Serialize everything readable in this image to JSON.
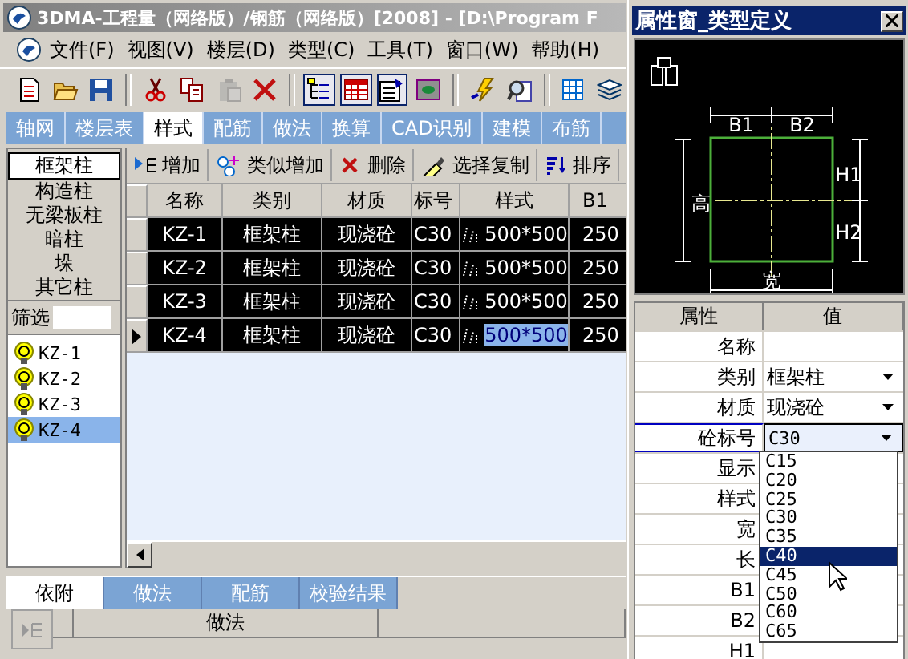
{
  "main_window": {
    "title": "3DMA-工程量（网络版）/钢筋（网络版）[2008] - [D:\\Program F",
    "menu": [
      "文件(F)",
      "视图(V)",
      "楼层(D)",
      "类型(C)",
      "工具(T)",
      "窗口(W)",
      "帮助(H)"
    ],
    "toolbar": [
      {
        "kind": "new"
      },
      {
        "kind": "open"
      },
      {
        "kind": "save"
      },
      {
        "kind": "sep"
      },
      {
        "kind": "cut"
      },
      {
        "kind": "copy"
      },
      {
        "kind": "paste",
        "disabled": true
      },
      {
        "kind": "delete"
      },
      {
        "kind": "sep"
      },
      {
        "kind": "tree",
        "on": true
      },
      {
        "kind": "table",
        "on": true
      },
      {
        "kind": "props",
        "on": true
      },
      {
        "kind": "display"
      },
      {
        "kind": "sep"
      },
      {
        "kind": "bolt"
      },
      {
        "kind": "find"
      },
      {
        "kind": "sep"
      },
      {
        "kind": "grid"
      },
      {
        "kind": "layers"
      }
    ],
    "tabs": [
      {
        "label": "轴网",
        "selected": false
      },
      {
        "label": "楼层表",
        "selected": false
      },
      {
        "label": "样式",
        "selected": true
      },
      {
        "label": "配筋",
        "selected": false
      },
      {
        "label": "做法",
        "selected": false
      },
      {
        "label": "换算",
        "selected": false
      },
      {
        "label": "CAD识别",
        "selected": false
      },
      {
        "label": "建模",
        "selected": false
      },
      {
        "label": "布筋",
        "selected": false
      }
    ],
    "categories": [
      {
        "label": "框架柱",
        "selected": true
      },
      {
        "label": "构造柱",
        "selected": false
      },
      {
        "label": "无梁板柱",
        "selected": false
      },
      {
        "label": "暗柱",
        "selected": false
      },
      {
        "label": "垛",
        "selected": false
      },
      {
        "label": "其它柱",
        "selected": false
      }
    ],
    "filter": {
      "label": "筛选"
    },
    "items": [
      {
        "label": "KZ-1",
        "selected": false
      },
      {
        "label": "KZ-2",
        "selected": false
      },
      {
        "label": "KZ-3",
        "selected": false
      },
      {
        "label": "KZ-4",
        "selected": true
      }
    ],
    "commands": [
      {
        "kind": "add",
        "label": "增加"
      },
      {
        "kind": "similar",
        "label": "类似增加"
      },
      {
        "kind": "delete",
        "label": "删除"
      },
      {
        "kind": "copy",
        "label": "选择复制"
      },
      {
        "kind": "sort",
        "label": "排序"
      }
    ],
    "table": {
      "columns": [
        "名称",
        "类别",
        "材质",
        "标号",
        "样式",
        "B1"
      ],
      "rows": [
        {
          "cells": [
            "KZ-1",
            "框架柱",
            "现浇砼",
            "C30",
            "500*500",
            "250"
          ],
          "current": false
        },
        {
          "cells": [
            "KZ-2",
            "框架柱",
            "现浇砼",
            "C30",
            "500*500",
            "250"
          ],
          "current": false
        },
        {
          "cells": [
            "KZ-3",
            "框架柱",
            "现浇砼",
            "C30",
            "500*500",
            "250"
          ],
          "current": false
        },
        {
          "cells": [
            "KZ-4",
            "框架柱",
            "现浇砼",
            "C30",
            "500*500",
            "250"
          ],
          "current": true
        }
      ]
    },
    "bottom_tabs": [
      {
        "label": "依附",
        "selected": true
      },
      {
        "label": "做法",
        "selected": false
      },
      {
        "label": "配筋",
        "selected": false
      },
      {
        "label": "校验结果",
        "selected": false
      }
    ],
    "sub_table": {
      "columns": [
        "做法"
      ]
    }
  },
  "property_window": {
    "title": "属性窗_类型定义",
    "diagram": {
      "top_labels": [
        "B1",
        "B2"
      ],
      "right_labels": [
        "H1",
        "H2"
      ],
      "left_label": "高",
      "bottom_label": "宽"
    },
    "columns": [
      "属性",
      "值"
    ],
    "rows": [
      {
        "name": "名称",
        "value": "",
        "dropdown": false,
        "selected": false
      },
      {
        "name": "类别",
        "value": "框架柱",
        "dropdown": true,
        "selected": false
      },
      {
        "name": "材质",
        "value": "现浇砼",
        "dropdown": true,
        "selected": false
      },
      {
        "name": "砼标号",
        "value": "C30",
        "dropdown": true,
        "selected": true
      },
      {
        "name": "显示",
        "value": "",
        "dropdown": false,
        "selected": false
      },
      {
        "name": "样式",
        "value": "",
        "dropdown": false,
        "selected": false
      },
      {
        "name": "宽",
        "value": "",
        "dropdown": false,
        "selected": false
      },
      {
        "name": "长",
        "value": "",
        "dropdown": false,
        "selected": false
      },
      {
        "name": "B1",
        "value": "",
        "dropdown": false,
        "selected": false
      },
      {
        "name": "B2",
        "value": "",
        "dropdown": false,
        "selected": false
      },
      {
        "name": "H1",
        "value": "",
        "dropdown": false,
        "selected": false
      }
    ],
    "dropdown": {
      "options": [
        {
          "label": "C15",
          "selected": false
        },
        {
          "label": "C20",
          "selected": false
        },
        {
          "label": "C25",
          "selected": false
        },
        {
          "label": "C30",
          "selected": false
        },
        {
          "label": "C35",
          "selected": false
        },
        {
          "label": "C40",
          "selected": true
        },
        {
          "label": "C45",
          "selected": false
        },
        {
          "label": "C50",
          "selected": false
        },
        {
          "label": "C60",
          "selected": false
        },
        {
          "label": "C65",
          "selected": false
        }
      ]
    }
  }
}
